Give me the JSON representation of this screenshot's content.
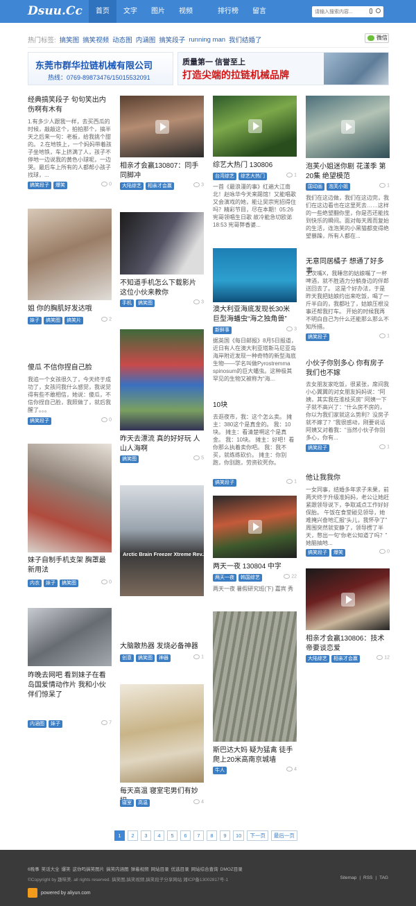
{
  "header": {
    "logo": "Dsuu.Cc",
    "nav": [
      "首页",
      "文字",
      "图片",
      "视频",
      "排行榜",
      "留言"
    ],
    "search_placeholder": "请输入搜索内容..."
  },
  "hot": {
    "label": "热门标签:",
    "tags": [
      "搞笑图",
      "搞笑视频",
      "动态图",
      "内涵图",
      "搞笑段子",
      "running man",
      "我们结婚了"
    ],
    "wechat": "微信"
  },
  "ads": {
    "company": "东莞市群华拉链机械有限公司",
    "hotline": "热线：0769-89873476/15015532091",
    "slogan": "质量第一  信誉至上",
    "brand": "打造尖端的拉链机械品牌"
  },
  "colors": {
    "brand": "#3f87d4",
    "tag": "#3b7dc2",
    "footer": "#3a3a3a"
  },
  "col1": [
    {
      "title": "经典搞笑段子  句句笑出内伤啊有木有",
      "desc": "1.有多少人跟我一样，去买西瓜的时候，敲敲这个，拍拍那个，搞半天之后来一句：老板，给我挑个甜的。 2.在地铁上，一个妈妈带着孩子坐地铁，车上挤满了人，孩子不停地一边说我的黄色小球呢，一边哭。最后车上所有的人都帮小孩子找球，...",
      "tags": [
        "搞笑段子",
        "爆笑"
      ],
      "count": "0"
    },
    {
      "title": "姐 你的胸肌好发达哦",
      "tags": [
        "妹子",
        "搞笑图",
        "搞笑片"
      ],
      "count": "2"
    },
    {
      "title": "傻瓜 不信你捏自己脸",
      "desc": "我追一个女孩很久了，今天终于成功了，女孩问我什么感觉，我说觉得有些不敢相信，她说：傻瓜，不信你捏自己脸，我照做了，就后我醒了。。。",
      "tags": [
        "搞笑段子"
      ],
      "count": "0"
    },
    {
      "title": "妹子自制手机支架  胸罩最新用法",
      "tags": [
        "内衣",
        "妹子",
        "搞笑图"
      ],
      "count": "0"
    },
    {
      "title": "昨晚去网吧  看到妹子在看岛国爱情动作片  我和小伙伴们惊呆了",
      "tags": [
        "内涵图",
        "妹子"
      ],
      "count": "7"
    }
  ],
  "col2": [
    {
      "title": "相亲才会赢130807：同手同脚冲",
      "tags": [
        "大陆综艺",
        "相亲才会赢"
      ],
      "count": "3"
    },
    {
      "title": "不知道手机怎么下载影片  这位小伙来教你",
      "tags": [
        "手机",
        "搞笑图"
      ],
      "count": "3"
    },
    {
      "title": "昨天去漂流 真的好好玩 人山人海啊",
      "tags": [
        "搞笑图"
      ],
      "count": "5"
    },
    {
      "title": "大脑散热器 发烧必备神器",
      "thumb_text": "Arctic Brain Freezer Xtreme Rev.2",
      "tags": [
        "创意",
        "搞笑图",
        "神器"
      ],
      "count": "1"
    },
    {
      "title": "每天高温 寝室宅男们有妙招",
      "tags": [
        "寝室",
        "高温"
      ],
      "count": "4"
    }
  ],
  "col3": [
    {
      "title": "综艺大热门 130806",
      "desc": "一首《最浪漫的事》红遍大江南北！赵咏华今天来踢馆！又能唱歌又会演戏的她，能让吴宗宪招得住吗？精彩节目，尽在本期！05:26 宪哥领唱生日歌  故冷能急切欧弟 18:53 宪哥弊香婆...",
      "tags": [
        "台湾综艺",
        "综艺大热门"
      ],
      "count": "1"
    },
    {
      "title": "澳大利亚海底发现长30米巨型海蟠虫“海之独角兽”",
      "desc": "据英国《每日邮报》8月5日报道，近日有人在澳大利亚塔斯马尼亚岛海岸附近发现一种奇特的新型海底生物——学名叫做Pyrostremma spinosum的巨大蟠虫。这种极其罕见的生物又被称为“海...",
      "tags": [
        "新鲜事"
      ],
      "count": "3"
    },
    {
      "title": "10块",
      "desc": "去逛夜市，我：这个怎么卖。   摊主：380这个是真金的。   我：10块。  摊主：看清楚啊这个是真金。 我：10块。  摊主：好吧！看你那么执着卖你吧。  我：我不买，就练练砍价。  摊主：你别跑，你别跑，劳资砍死你。",
      "tags": [
        "搞笑段子"
      ],
      "count": "1"
    },
    {
      "title": "两天一夜 130804 中字",
      "tags": [
        "两天一夜",
        "韩国综艺"
      ],
      "count": "22",
      "desc": "两天一夜 暑假研究班(下) 嘉宾 秀爱"
    },
    {
      "title": "斯巴达大妈 疑为猛禽 徒手爬上20米高南京城墙",
      "tags": [
        "牛人"
      ],
      "count": "4"
    }
  ],
  "col4": [
    {
      "title": "泡芙小姐迷你剧 花漾季 第20集 绝望模范",
      "desc": "我们在这边做，我们在这边完，我们在这边看也在这里死去……这样的一些绝望翻你里，你是否还能找到快乐的瞬间。面对每天周而复始的生活，连泡芙的小黑猫都变得绝望暴躁，所有人都在...",
      "tags": [
        "国动画",
        "泡芙小姐"
      ],
      "count": "1"
    },
    {
      "title": "无意同居橘子 想通了好多事",
      "desc": "上次嘴X，我睡您的姑娘嘴了一杯啤酒，就不胜酒力分躺身边的伴郎送回去了。 这是个好办法，于是昨天我把姑娘约出来吃饭，喝了一斤半白的，我都吐了，姑娘压根没事还帮我打车。 开始的时候我再不明白自己为什么还能那么那么不知所措。",
      "tags": [
        "搞笑段子"
      ],
      "count": "1"
    },
    {
      "title": "小伙子你别多心  你有房子我们也不嫁",
      "desc": "去女朋友家吃饭，很紧张，席间我小心翼翼的对女朋友妈妈说：“阿姨，其实我在淮枝买房” 阿姨一下子就不高兴了：“什么房不房的，你以为我们家就这么势利？没房子就不嫁了？”我很感动，刚要说话阿姨又对着我：“当然小伙子你别多心，你有...",
      "tags": [
        "搞笑段子"
      ],
      "count": "1"
    },
    {
      "title": "他让我我你",
      "desc": "一女同事，结婚多年求子未果，前两天终于升级准妈妈，老公让她赶紧跟领导说下，争取减点工作好好保胎。 午饭在食堂碰见领导，她难掩兴奋地汇报“头儿，我怀孕了”  周围突然就安静了，领导楞了半天，憋出一句“你老公知道了吗？” 她脑抽地...",
      "tags": [
        "搞笑段子",
        "爆笑"
      ],
      "count": "0"
    },
    {
      "title": "相亲才会赢130806：技术帝要谈恋爱",
      "tags": [
        "大陆综艺",
        "相亲才会赢"
      ],
      "count": "12"
    }
  ],
  "pager": [
    "1",
    "2",
    "3",
    "4",
    "5",
    "6",
    "7",
    "8",
    "9",
    "10",
    "下一页",
    "最后一页"
  ],
  "footer": {
    "links": [
      "6晚事",
      "笑话大全",
      "爆笑",
      "这你吗搞笑图片",
      "搞笑内涵图",
      "弹着视频",
      "网站目录",
      "优选目录",
      "网站综合查询",
      "DMOZ目录"
    ],
    "copy": "©Copyright by 趣味美. all rights reserved. 搞笑图,搞笑视频,搞笑段子分享网站 湘ICP备13002817号-1",
    "right": [
      "Sitemap",
      "RSS",
      "TAG"
    ],
    "powered": "powered by aliyun.com"
  }
}
